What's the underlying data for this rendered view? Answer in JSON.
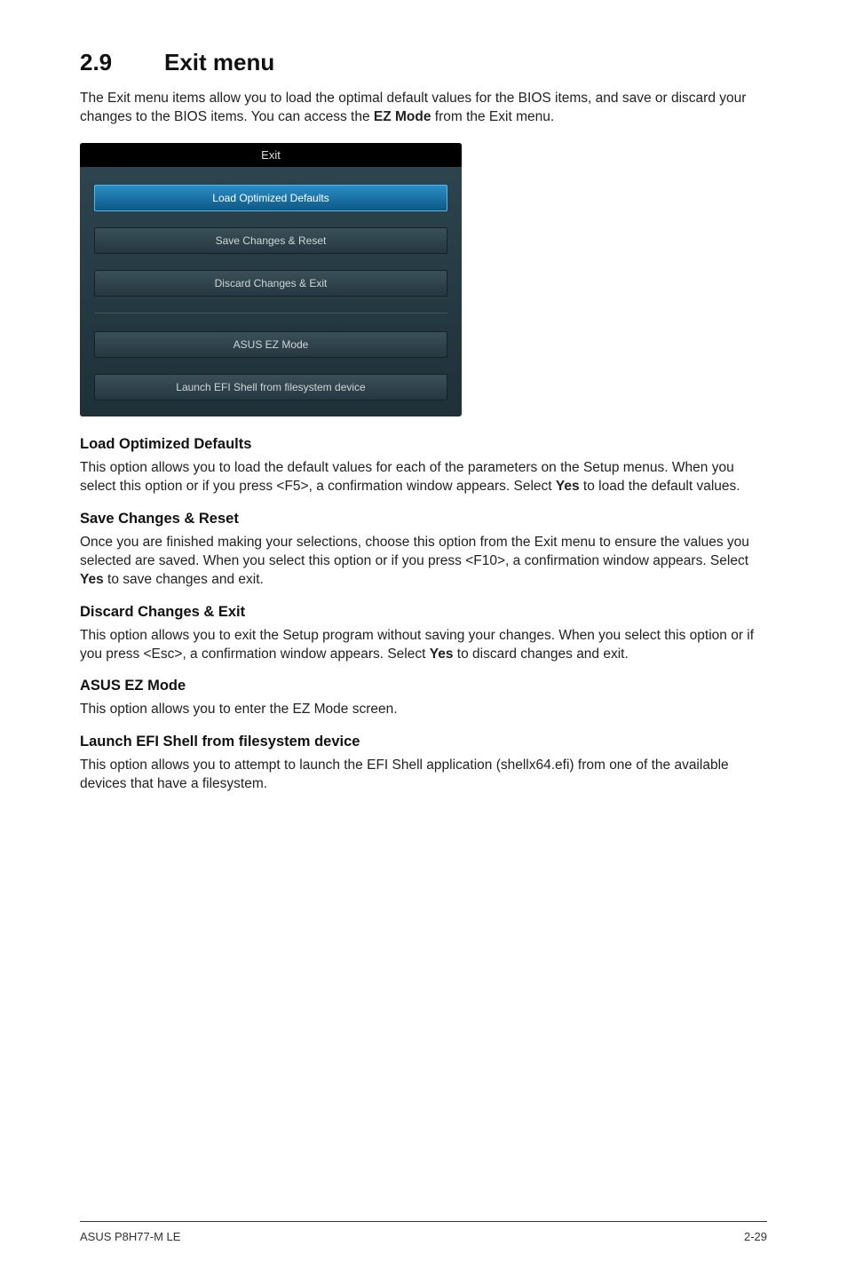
{
  "heading": {
    "number": "2.9",
    "title": "Exit menu"
  },
  "intro": "The Exit menu items allow you to load the optimal default values for the BIOS items, and save or discard your changes to the BIOS items. You can access the ",
  "introBold": "EZ Mode",
  "introTail": " from the Exit menu.",
  "bios": {
    "header": "Exit",
    "items": [
      "Load Optimized Defaults",
      "Save Changes & Reset",
      "Discard Changes & Exit"
    ],
    "items2": [
      "ASUS EZ Mode",
      "Launch EFI Shell from filesystem device"
    ]
  },
  "sections": [
    {
      "title": "Load Optimized Defaults",
      "pre": "This option allows you to load the default values for each of the parameters on the Setup menus. When you select this option or if you press <F5>, a confirmation window appears. Select ",
      "bold": "Yes",
      "post": " to load the default values."
    },
    {
      "title": "Save Changes & Reset",
      "pre": "Once you are finished making your selections, choose this option from the Exit menu to ensure the values you selected are saved. When you select this option or if you press <F10>, a confirmation window appears. Select ",
      "bold": "Yes",
      "post": " to save changes and exit."
    },
    {
      "title": "Discard Changes & Exit",
      "pre": "This option allows you to exit the Setup program without saving your changes. When you select this option or if you press <Esc>, a confirmation window appears. Select ",
      "bold": "Yes",
      "post": " to discard changes and exit."
    },
    {
      "title": "ASUS EZ Mode",
      "pre": "This option allows you to enter the EZ Mode screen.",
      "bold": "",
      "post": ""
    },
    {
      "title": "Launch EFI Shell from filesystem device",
      "pre": "This option allows you to attempt to launch the EFI Shell application (shellx64.efi) from one of the available devices that have a filesystem.",
      "bold": "",
      "post": ""
    }
  ],
  "footer": {
    "left": "ASUS P8H77-M LE",
    "right": "2-29"
  }
}
